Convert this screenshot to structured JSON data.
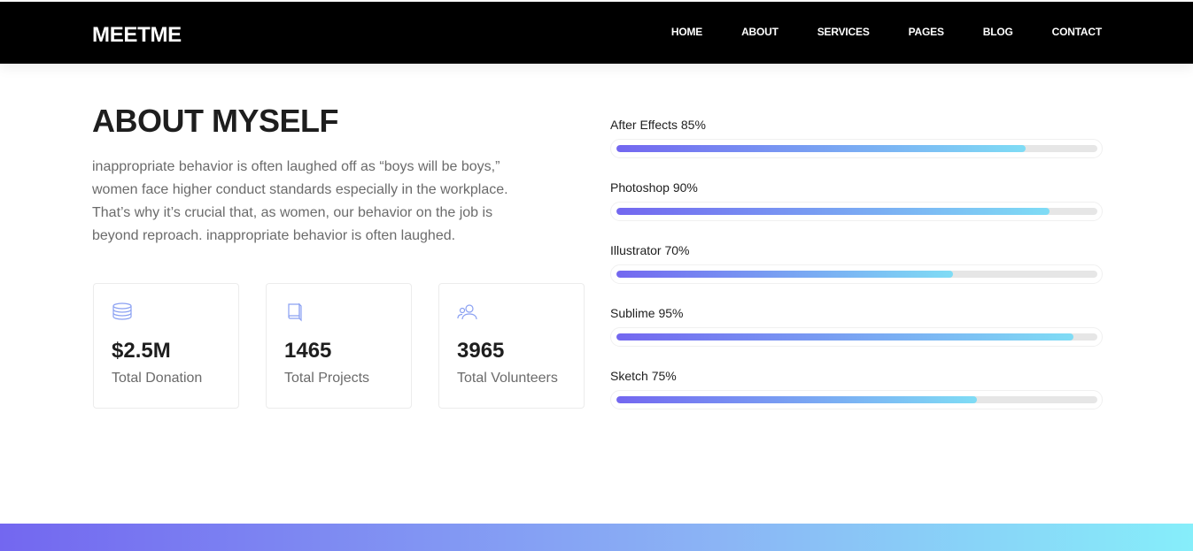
{
  "header": {
    "brand": "MEETME",
    "nav": [
      "HOME",
      "ABOUT",
      "SERVICES",
      "PAGES",
      "BLOG",
      "CONTACT"
    ]
  },
  "about": {
    "title": "ABOUT MYSELF",
    "text": "inappropriate behavior is often laughed off as “boys will be boys,” women face higher conduct standards especially in the workplace. That’s why it’s crucial that, as women, our behavior on the job is beyond reproach. inappropriate behavior is often laughed."
  },
  "stats": [
    {
      "icon": "database-icon",
      "value": "$2.5M",
      "label": "Total Donation"
    },
    {
      "icon": "book-icon",
      "value": "1465",
      "label": "Total Projects"
    },
    {
      "icon": "users-icon",
      "value": "3965",
      "label": "Total Volunteers"
    }
  ],
  "skills": [
    {
      "label": "After Effects 85%",
      "percent": 85
    },
    {
      "label": "Photoshop 90%",
      "percent": 90
    },
    {
      "label": "Illustrator 70%",
      "percent": 70
    },
    {
      "label": "Sublime 95%",
      "percent": 95
    },
    {
      "label": "Sketch 75%",
      "percent": 75
    }
  ],
  "colors": {
    "gradient_start": "#7367f0",
    "gradient_end": "#86eefa",
    "nav_background": "#000000"
  }
}
